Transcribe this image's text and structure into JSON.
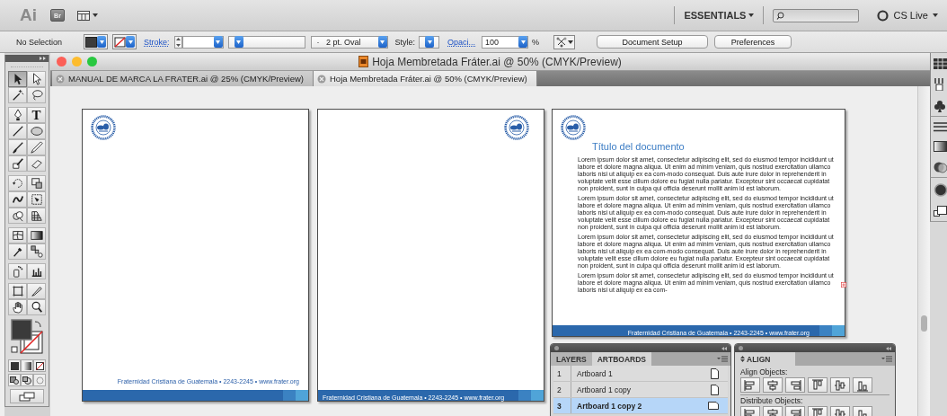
{
  "app_bar": {
    "logo": "Ai",
    "bridge": "Br",
    "workspace": "ESSENTIALS",
    "cs_live": "CS Live"
  },
  "control_bar": {
    "selection": "No Selection",
    "stroke_label": "Stroke:",
    "brush": "2 pt. Oval",
    "brush_dot": "·",
    "style_label": "Style:",
    "opacity_label": "Opaci...",
    "opacity": "100",
    "percent": "%",
    "buttons": [
      "Document Setup",
      "Preferences"
    ]
  },
  "tool_groups": [
    [
      {
        "kind": "selection",
        "selected": true
      },
      {
        "kind": "direct-selection",
        "selected": false
      },
      {
        "kind": "magic-wand",
        "selected": false
      },
      {
        "kind": "lasso",
        "selected": false
      }
    ],
    [
      {
        "kind": "pen",
        "selected": false
      },
      {
        "kind": "type",
        "glyph": "T",
        "selected": false
      },
      {
        "kind": "line",
        "selected": false
      },
      {
        "kind": "ellipse",
        "selected": false
      },
      {
        "kind": "paintbrush",
        "selected": false
      },
      {
        "kind": "pencil",
        "selected": false
      },
      {
        "kind": "blob-brush",
        "selected": false
      },
      {
        "kind": "eraser",
        "selected": false
      }
    ],
    [
      {
        "kind": "rotate",
        "selected": false
      },
      {
        "kind": "scale",
        "selected": false
      },
      {
        "kind": "warp",
        "selected": false
      },
      {
        "kind": "free-transform",
        "selected": false
      },
      {
        "kind": "shape-builder",
        "selected": false
      },
      {
        "kind": "perspective-grid",
        "selected": false
      }
    ],
    [
      {
        "kind": "mesh",
        "selected": false
      },
      {
        "kind": "gradient",
        "selected": false
      },
      {
        "kind": "eyedropper",
        "selected": false
      },
      {
        "kind": "blend",
        "selected": false
      }
    ],
    [
      {
        "kind": "symbol-sprayer",
        "selected": false
      },
      {
        "kind": "graph",
        "selected": false
      }
    ],
    [
      {
        "kind": "artboard",
        "selected": false
      },
      {
        "kind": "slice",
        "selected": false
      },
      {
        "kind": "hand",
        "selected": false
      },
      {
        "kind": "zoom",
        "selected": false
      }
    ]
  ],
  "document": {
    "title": "Hoja Membretada Fráter.ai @ 50% (CMYK/Preview)",
    "tabs": [
      {
        "label": "MANUAL DE MARCA LA FRATER.ai @ 25% (CMYK/Preview)",
        "selected": false
      },
      {
        "label": "Hoja Membretada Fráter.ai @ 50% (CMYK/Preview)",
        "selected": true
      }
    ]
  },
  "artboards": [
    {
      "kind": "footed",
      "footer": "Fraternidad Cristiana de Guatemala • 2243-2245 • www.frater.org"
    },
    {
      "kind": "banded",
      "footer": "Fraternidad Cristiana de Guatemala • 2243-2245 • www.frater.org"
    },
    {
      "kind": "document",
      "footer": "Fraternidad Cristiana de Guatemala • 2243-2245 • www.frater.org",
      "title": "Título del documento",
      "paragraphs": [
        "Lorem ipsum dolor sit amet, consectetur adipiscing elit, sed do eiusmod tempor incididunt ut labore et dolore magna aliqua. Ut enim ad minim veniam, quis nostrud exercitation ullamco laboris nisi ut aliquip ex ea com-modo consequat. Duis aute irure dolor in reprehenderit in voluptate velit esse cillum dolore eu fugiat nulla pariatur. Excepteur sint occaecat cupidatat non proident, sunt in culpa qui officia deserunt mollit anim id est laborum.",
        "Lorem ipsum dolor sit amet, consectetur adipiscing elit, sed do eiusmod tempor incididunt ut labore et dolore magna aliqua. Ut enim ad minim veniam, quis nostrud exercitation ullamco laboris nisi ut aliquip ex ea com-modo consequat. Duis aute irure dolor in reprehenderit in voluptate velit esse cillum dolore eu fugiat nulla pariatur. Excepteur sint occaecat cupidatat non proident, sunt in culpa qui officia deserunt mollit anim id est laborum.",
        "Lorem ipsum dolor sit amet, consectetur adipiscing elit, sed do eiusmod tempor incididunt ut labore et dolore magna aliqua. Ut enim ad minim veniam, quis nostrud exercitation ullamco laboris nisi ut aliquip ex ea com-modo consequat. Duis aute irure dolor in reprehenderit in voluptate velit esse cillum dolore eu fugiat nulla pariatur. Excepteur sint occaecat cupidatat non proident, sunt in culpa qui officia deserunt mollit anim id est laborum.",
        "Lorem ipsum dolor sit amet, consectetur adipiscing elit, sed do eiusmod tempor incididunt ut labore et dolore magna aliqua. Ut enim ad minim veniam, quis nostrud exercitation ullamco laboris nisi ut aliquip ex ea com-"
      ]
    }
  ],
  "artboards_panel": {
    "tabs": [
      {
        "label": "LAYERS",
        "selected": false
      },
      {
        "label": "ARTBOARDS",
        "selected": true
      }
    ],
    "rows": [
      {
        "number": "1",
        "name": "Artboard 1",
        "selected": false
      },
      {
        "number": "2",
        "name": "Artboard 1 copy",
        "selected": false
      },
      {
        "number": "3",
        "name": "Artboard 1 copy 2",
        "selected": true
      }
    ]
  },
  "align_panel": {
    "tab": "ALIGN",
    "align_label": "Align Objects:",
    "distribute_label": "Distribute Objects:"
  }
}
